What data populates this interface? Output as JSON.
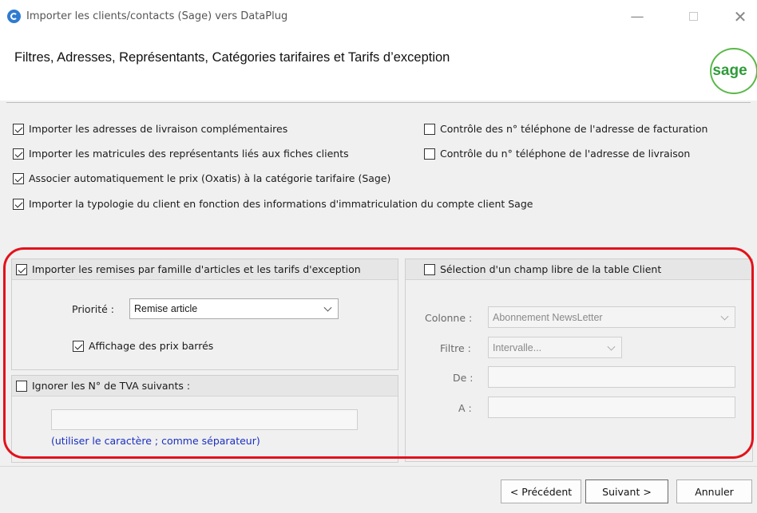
{
  "window": {
    "title": "Importer les clients/contacts (Sage) vers DataPlug",
    "minimize": "—",
    "close": "✕"
  },
  "header": {
    "title": "Filtres, Adresses, Représentants, Catégories tarifaires et Tarifs d’exception",
    "logo_text": "sage"
  },
  "options": {
    "delivery_addresses": {
      "label": "Importer les adresses de livraison complémentaires",
      "checked": true
    },
    "representatives": {
      "label": "Importer les matricules des représentants liés aux fiches clients",
      "checked": true
    },
    "auto_price_category": {
      "label": "Associer automatiquement le prix (Oxatis) à la catégorie tarifaire (Sage)",
      "checked": true
    },
    "typology": {
      "label": "Importer la typologie du client en fonction des informations d'immatriculation du compte client Sage",
      "checked": true
    },
    "billing_phone_check": {
      "label": "Contrôle des n° téléphone de l'adresse de facturation",
      "checked": false
    },
    "delivery_phone_check": {
      "label": "Contrôle du n° téléphone de l'adresse de livraison",
      "checked": false
    }
  },
  "discounts": {
    "label": "Importer les remises par famille d'articles et les tarifs d'exception",
    "checked": true,
    "priority_label": "Priorité :",
    "priority_value": "Remise article",
    "strikethrough_label": "Affichage des prix barrés",
    "strikethrough_checked": true
  },
  "vat": {
    "label": "Ignorer les N° de TVA suivants :",
    "checked": false,
    "value": "",
    "hint": "(utiliser le caractère ; comme séparateur)"
  },
  "free_field": {
    "label": "Sélection d'un champ libre de la table Client",
    "checked": false,
    "column_label": "Colonne :",
    "column_value": "Abonnement NewsLetter",
    "filter_label": "Filtre :",
    "filter_value": "Intervalle...",
    "from_label": "De :",
    "from_value": "",
    "to_label": "A :",
    "to_value": ""
  },
  "buttons": {
    "previous": "< Précédent",
    "next": "Suivant >",
    "cancel": "Annuler"
  },
  "colors": {
    "highlight": "#e3121b",
    "hint_text": "#1a2fbf",
    "brand_green": "#58b947"
  }
}
